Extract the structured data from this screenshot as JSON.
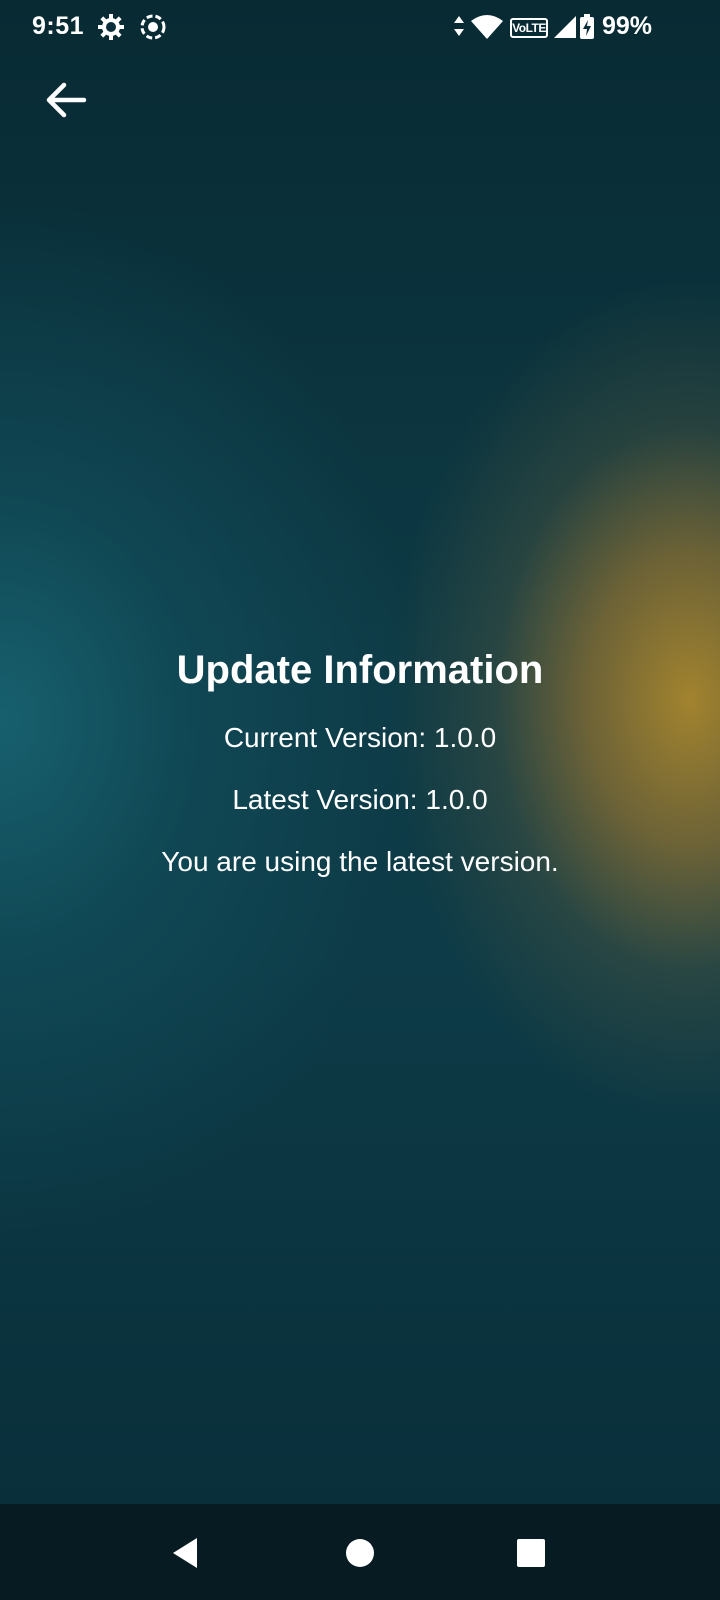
{
  "status_bar": {
    "time": "9:51",
    "battery_percent": "99%",
    "network_label": "VoLTE",
    "icons": [
      "gear-icon",
      "screen-record-icon",
      "data-arrows-icon",
      "wifi-icon",
      "signal-icon",
      "battery-charging-icon"
    ]
  },
  "header": {
    "back_icon": "arrow-left-icon"
  },
  "main": {
    "title": "Update Information",
    "current_version": "Current Version: 1.0.0",
    "latest_version": "Latest Version: 1.0.0",
    "status_message": "You are using the latest version."
  },
  "nav_bar": {
    "icons": [
      "back-triangle-icon",
      "home-circle-icon",
      "recents-square-icon"
    ]
  },
  "colors": {
    "text": "#ffffff",
    "background_teal": "#0b2f3a",
    "accent_gold": "#aa872d",
    "nav_background": "#071c22"
  }
}
